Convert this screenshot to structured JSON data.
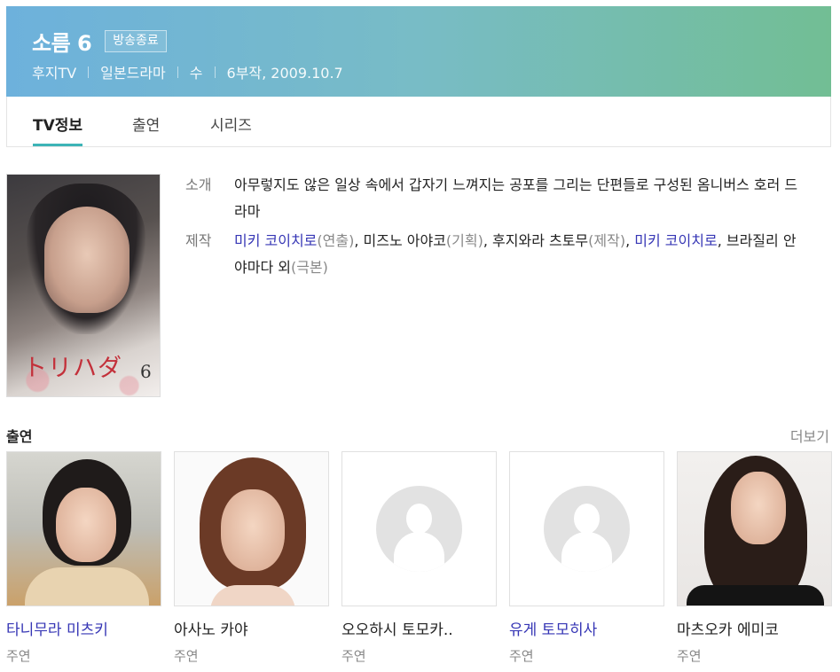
{
  "header": {
    "title": "소름 6",
    "badge": "방송종료",
    "meta": [
      "후지TV",
      "일본드라마",
      "수",
      "6부작, 2009.10.7"
    ]
  },
  "tabs": [
    {
      "label": "TV정보",
      "active": true
    },
    {
      "label": "출연",
      "active": false
    },
    {
      "label": "시리즈",
      "active": false
    }
  ],
  "poster": {
    "title_text": "トリハダ",
    "number_text": "6"
  },
  "info": {
    "intro_label": "소개",
    "intro_text": "아무렇지도 않은 일상 속에서 갑자기 느껴지는 공포를 그리는 단편들로 구성된 옴니버스 호러 드라마",
    "production_label": "제작",
    "production": {
      "p1_name": "미키 코이치로",
      "p1_role": "(연출)",
      "p2_name": "미즈노 아야코",
      "p2_role": "(기획)",
      "p3_name": "후지와라 츠토무",
      "p3_role": "(제작)",
      "p4_name": "미키 코이치로",
      "p5_name": "브라질리 안 야마다 외",
      "p5_role": "(극본)"
    }
  },
  "cast": {
    "title": "출연",
    "more_label": "더보기",
    "members": [
      {
        "name": "타니무라 미츠키",
        "role": "주연",
        "linked": true
      },
      {
        "name": "아사노 카야",
        "role": "주연",
        "linked": false
      },
      {
        "name": "오오하시 토모카..",
        "role": "주연",
        "linked": false
      },
      {
        "name": "유게 토모히사",
        "role": "주연",
        "linked": true
      },
      {
        "name": "마츠오카 에미코",
        "role": "주연",
        "linked": false
      }
    ]
  },
  "colors": {
    "header_gradient_start": "#6db1dc",
    "header_gradient_end": "#72be94",
    "tab_active_underline": "#3db4b7",
    "link": "#3636b5"
  }
}
